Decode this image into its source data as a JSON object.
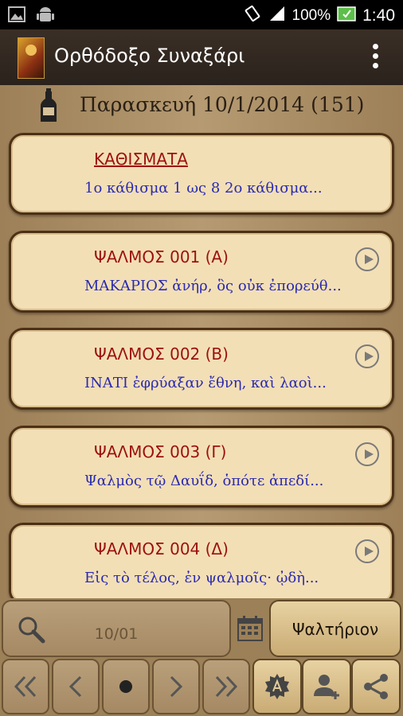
{
  "status": {
    "battery": "100%",
    "time": "1:40"
  },
  "app": {
    "title": "Ορθόδοξο Συναξάρι"
  },
  "date": {
    "text": "Παρασκευή 10/1/2014 (151)"
  },
  "cards": [
    {
      "title": "ΚΑΘΙΣΜΑΤΑ",
      "subtitle": "1ο κάθισμα 1 ως 8 2ο κάθισμα..."
    },
    {
      "title": "ΨΑΛΜΟΣ 001 (Α)",
      "subtitle": "ΜΑΚΑΡΙΟΣ ἀνήρ, ὃς οὐκ ἐπορεύθ..."
    },
    {
      "title": "ΨΑΛΜΟΣ 002 (Β)",
      "subtitle": "ΙΝΑΤΙ ἐφρύαξαν ἔθνη, καὶ λαοὶ..."
    },
    {
      "title": "ΨΑΛΜΟΣ 003 (Γ)",
      "subtitle": "Ψαλμὸς τῷ Δαυΐδ, ὁπότε ἀπεδί..."
    },
    {
      "title": "ΨΑΛΜΟΣ 004 (Δ)",
      "subtitle": "Εἰς τὸ τέλος, ἐν ψαλμοῖς· ᾠδὴ..."
    }
  ],
  "bottom": {
    "search_value": "10/01",
    "book_label": "Ψαλτήριον"
  }
}
